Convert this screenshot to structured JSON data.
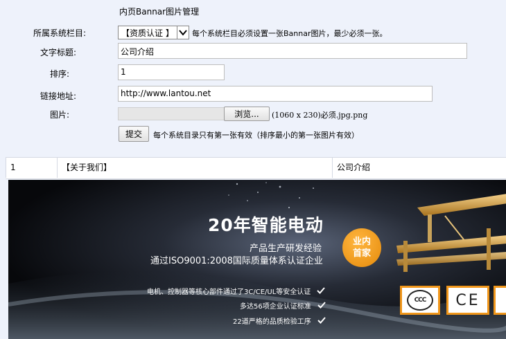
{
  "page": {
    "title": "内页Bannar图片管理"
  },
  "form": {
    "category_label": "所属系统栏目:",
    "category_value": "【资质认证 】",
    "category_note": "每个系统栏目必须设置一张Bannar图片，最少必须一张。",
    "title_label": "文字标题:",
    "title_value": "公司介绍",
    "order_label": "排序:",
    "order_value": "1",
    "link_label": "链接地址:",
    "link_value": "http://www.lantou.net",
    "image_label": "图片:",
    "browse_label": "浏览...",
    "image_note": "(1060 x 230)必须.jpg.png",
    "submit_label": "提交",
    "submit_note": "每个系统目录只有第一张有效（排序最小的第一张图片有效）"
  },
  "table": {
    "rows": [
      {
        "order": "1",
        "category": "【关于我们】",
        "title": "公司介绍"
      }
    ]
  },
  "banner": {
    "headline": "20年智能电动",
    "line1": "产品生产研发经验",
    "line2": "通过ISO9001:2008国际质量体系认证企业",
    "badge": "业内首家",
    "features": [
      "电机、控制器等核心部件通过了3C/CE/UL等安全认证",
      "多达56项企业认证标准",
      "22道严格的品质检验工序"
    ],
    "cert1": "CCC",
    "cert2": "CE"
  },
  "colors": {
    "accent": "#f39c12",
    "page_bg": "#eef2fb"
  },
  "icons": {
    "dropdown": "chevron-down-icon",
    "check": "check-icon"
  }
}
